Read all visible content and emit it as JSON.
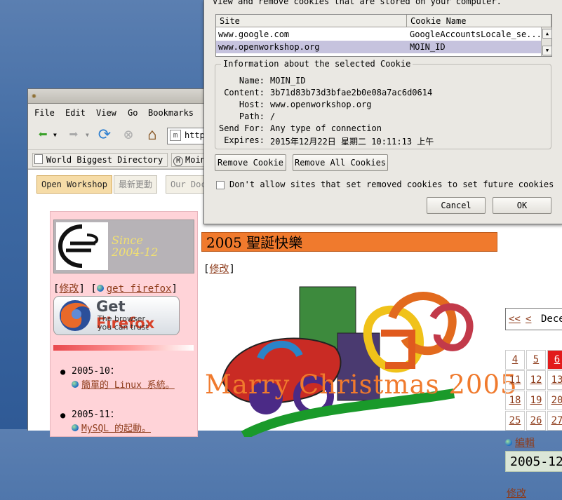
{
  "dialog": {
    "description": "View and remove cookies that are stored on your computer.",
    "table": {
      "columns": [
        "Site",
        "Cookie Name"
      ],
      "rows": [
        {
          "site": "www.google.com",
          "name": "GoogleAccountsLocale_se..."
        },
        {
          "site": "www.openworkshop.org",
          "name": "MOIN_ID"
        }
      ]
    },
    "info": {
      "legend": "Information about the selected Cookie",
      "name_label": "Name:",
      "name": "MOIN_ID",
      "content_label": "Content:",
      "content": "3b71d83b73d3bfae2b0e08a7ac6d0614",
      "host_label": "Host:",
      "host": "www.openworkshop.org",
      "path_label": "Path:",
      "path": "/",
      "sendfor_label": "Send For:",
      "sendfor": "Any type of connection",
      "expires_label": "Expires:",
      "expires": "2015年12月22日 星期二 10:11:13 上午"
    },
    "remove_label": "Remove Cookie",
    "remove_all_label": "Remove All Cookies",
    "checkbox_label": "Don't allow sites that set removed cookies to set future cookies",
    "cancel_label": "Cancel",
    "ok_label": "OK"
  },
  "browser": {
    "menu": [
      "File",
      "Edit",
      "View",
      "Go",
      "Bookmarks"
    ],
    "url_prefix": "http",
    "bookmarks": [
      "World Biggest Directory",
      "Moin"
    ]
  },
  "page": {
    "tabs": [
      "Open Workshop",
      "最新更動",
      "Our Doc"
    ],
    "logo_since": "Since",
    "logo_date": "2004-12",
    "edit_label": "修改",
    "get_firefox_label": "get firefox",
    "badge_title_1": "Get ",
    "badge_title_2": "Firefox",
    "badge_line1": "The browser",
    "badge_line2": "you can trust",
    "entries": [
      {
        "month": "2005-10：",
        "link": "簡單的 Linux 系統。"
      },
      {
        "month": "2005-11：",
        "link": "MySQL 的起動。"
      }
    ],
    "xmas_title": "2005 聖誕快樂",
    "xmas_edit": "修改",
    "xmas_banner": "Marry Christmas 2005",
    "calendar": {
      "nav_prev2": "<<",
      "nav_prev": "<",
      "month": "Dece",
      "cells": [
        "4",
        "5",
        "6",
        "11",
        "12",
        "13",
        "18",
        "19",
        "20",
        "25",
        "26",
        "27"
      ],
      "today": "6"
    },
    "edit_small": "編輯",
    "date_heading": "2005-12",
    "bottom_edit": "修改"
  }
}
